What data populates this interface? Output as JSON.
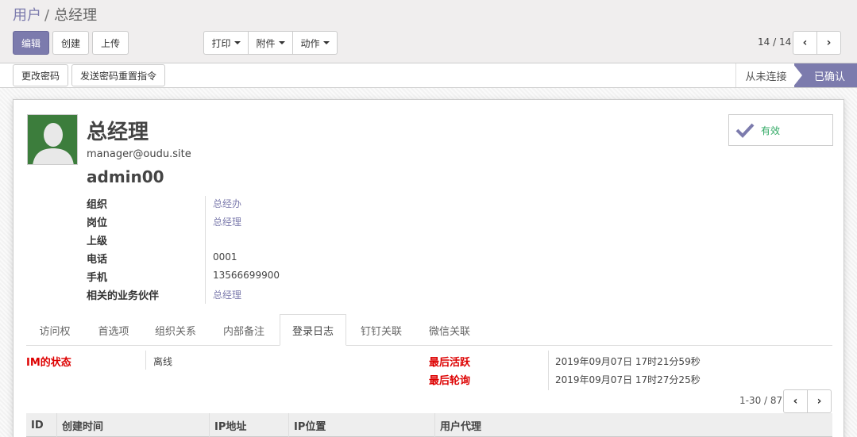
{
  "breadcrumb": {
    "parent": "用户",
    "separator": "/",
    "current": "总经理"
  },
  "toolbar": {
    "edit": "编辑",
    "create": "创建",
    "upload": "上传",
    "print": "打印",
    "attachment": "附件",
    "action": "动作"
  },
  "pager": {
    "value": "14 / 14"
  },
  "statusbar": {
    "change_password": "更改密码",
    "send_reset": "发送密码重置指令",
    "stage_never": "从未连接",
    "stage_confirmed": "已确认"
  },
  "record": {
    "name": "总经理",
    "email": "manager@oudu.site",
    "login": "admin00",
    "active_label": "有效"
  },
  "fields": [
    {
      "label": "组织",
      "value": "总经办"
    },
    {
      "label": "岗位",
      "value": "总经理"
    },
    {
      "label": "上级",
      "value": ""
    },
    {
      "label": "电话",
      "value": "0001"
    },
    {
      "label": "手机",
      "value": "13566699900"
    },
    {
      "label": "相关的业务伙伴",
      "value": "总经理"
    }
  ],
  "tabs": [
    "访问权",
    "首选项",
    "组织关系",
    "内部备注",
    "登录日志",
    "钉钉关联",
    "微信关联"
  ],
  "im": {
    "status_label": "IM的状态",
    "status_value": "离线",
    "last_active_label": "最后活跃",
    "last_active_value": "2019年09月07日 17时21分59秒",
    "last_poll_label": "最后轮询",
    "last_poll_value": "2019年09月07日 17时27分25秒"
  },
  "log_pager": {
    "value": "1-30 / 87"
  },
  "log_table": {
    "columns": [
      "ID",
      "创建时间",
      "IP地址",
      "IP位置",
      "用户代理"
    ]
  },
  "colors": {
    "primary": "#7c7bad",
    "danger": "#dd0000",
    "success": "#33aa66"
  }
}
